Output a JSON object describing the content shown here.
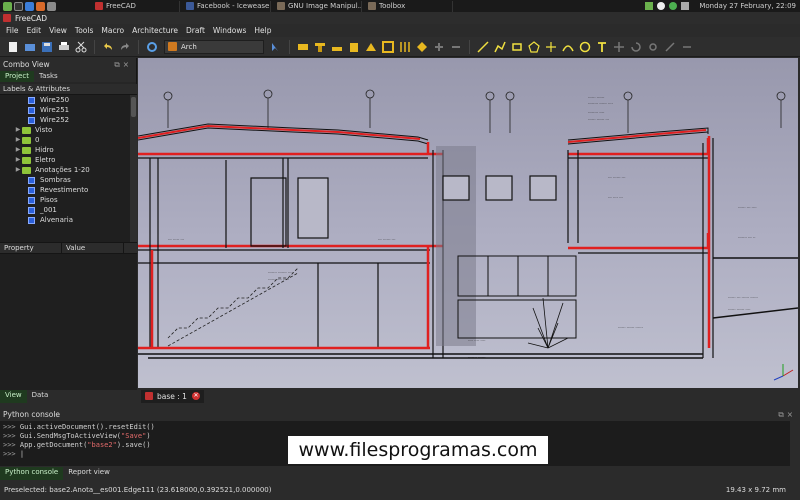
{
  "taskbar": {
    "tasks": [
      {
        "label": "FreeCAD",
        "color": "#c03030"
      },
      {
        "label": "Facebook - Iceweasel",
        "color": "#3b5998"
      },
      {
        "label": "GNU Image Manipul...",
        "color": "#7a6a58"
      },
      {
        "label": "Toolbox",
        "color": "#7a6a58"
      }
    ],
    "datetime": "Monday 27 February, 22:09"
  },
  "window": {
    "title": "FreeCAD"
  },
  "menu": [
    "File",
    "Edit",
    "View",
    "Tools",
    "Macro",
    "Architecture",
    "Draft",
    "Windows",
    "Help"
  ],
  "toolbar": {
    "workbench": "Arch"
  },
  "combo": {
    "title": "Combo View",
    "tabs": [
      "Project",
      "Tasks"
    ],
    "tree_header": "Labels & Attributes",
    "tree": [
      {
        "label": "Wire250",
        "kind": "object",
        "expand": ""
      },
      {
        "label": "Wire251",
        "kind": "object",
        "expand": ""
      },
      {
        "label": "Wire252",
        "kind": "object",
        "expand": ""
      },
      {
        "label": "Visto",
        "kind": "folder",
        "expand": "▶"
      },
      {
        "label": "0",
        "kind": "folder",
        "expand": "▶"
      },
      {
        "label": "Hidro",
        "kind": "folder",
        "expand": "▶"
      },
      {
        "label": "Eletro",
        "kind": "folder",
        "expand": "▶"
      },
      {
        "label": "Anotações 1-20",
        "kind": "folder",
        "expand": "▶"
      },
      {
        "label": "Sombras",
        "kind": "object",
        "expand": ""
      },
      {
        "label": "Revestimento",
        "kind": "object",
        "expand": ""
      },
      {
        "label": "Pisos",
        "kind": "object",
        "expand": ""
      },
      {
        "label": "_001",
        "kind": "object",
        "expand": ""
      },
      {
        "label": "Alvenaria",
        "kind": "object",
        "expand": ""
      }
    ],
    "props_headers": [
      "Property",
      "Value"
    ],
    "bottom_tabs": [
      "View",
      "Data"
    ]
  },
  "document_tab": {
    "label": "base : 1"
  },
  "console": {
    "title": "Python console",
    "lines": [
      {
        "prompt": ">>> ",
        "code": "Gui.activeDocument().resetEdit()",
        "str": ""
      },
      {
        "prompt": ">>> ",
        "code": "Gui.SendMsgToActiveView(",
        "str": "\"Save\"",
        "tail": ")"
      },
      {
        "prompt": ">>> ",
        "code": "App.getDocument(",
        "str": "\"base2\"",
        "tail": ").save()"
      },
      {
        "prompt": ">>> ",
        "code": "|",
        "str": ""
      }
    ],
    "tabs": [
      "Python console",
      "Report view"
    ]
  },
  "status": {
    "message": "Preselected: base2.Anota__es001.Edge111 (23.618000,0.392521,0.000000)",
    "dims": "19.43 x 9.72 mm"
  },
  "watermark": "www.filesprogramas.com",
  "colors": {
    "accent_red": "#e03030",
    "view_bg_top": "#9898ad",
    "view_bg_bottom": "#bfc0cf"
  }
}
